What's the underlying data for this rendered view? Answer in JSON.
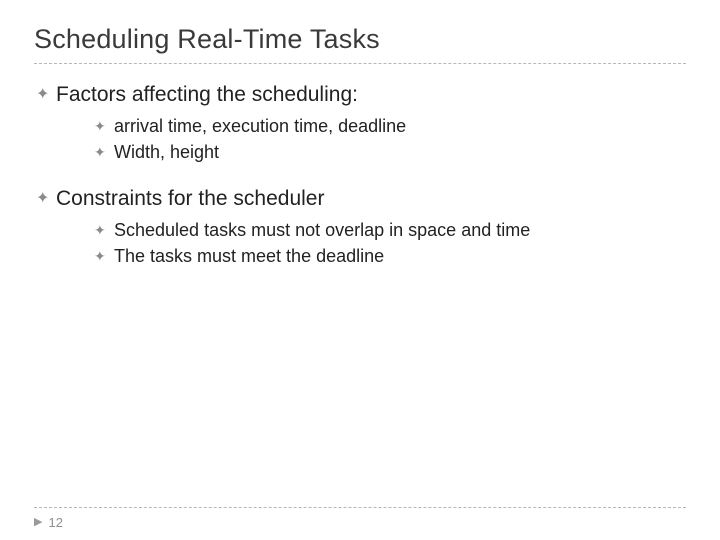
{
  "title": "Scheduling Real-Time Tasks",
  "bullets": [
    {
      "text": "Factors affecting the scheduling:",
      "sub": [
        "arrival time, execution time, deadline",
        "Width, height"
      ]
    },
    {
      "text": "Constraints for the scheduler",
      "sub": [
        "Scheduled tasks must not overlap in space and time",
        "The tasks must meet the deadline"
      ]
    }
  ],
  "page_number": "12",
  "glyphs": {
    "bullet": "✦",
    "arrow": "▶"
  }
}
